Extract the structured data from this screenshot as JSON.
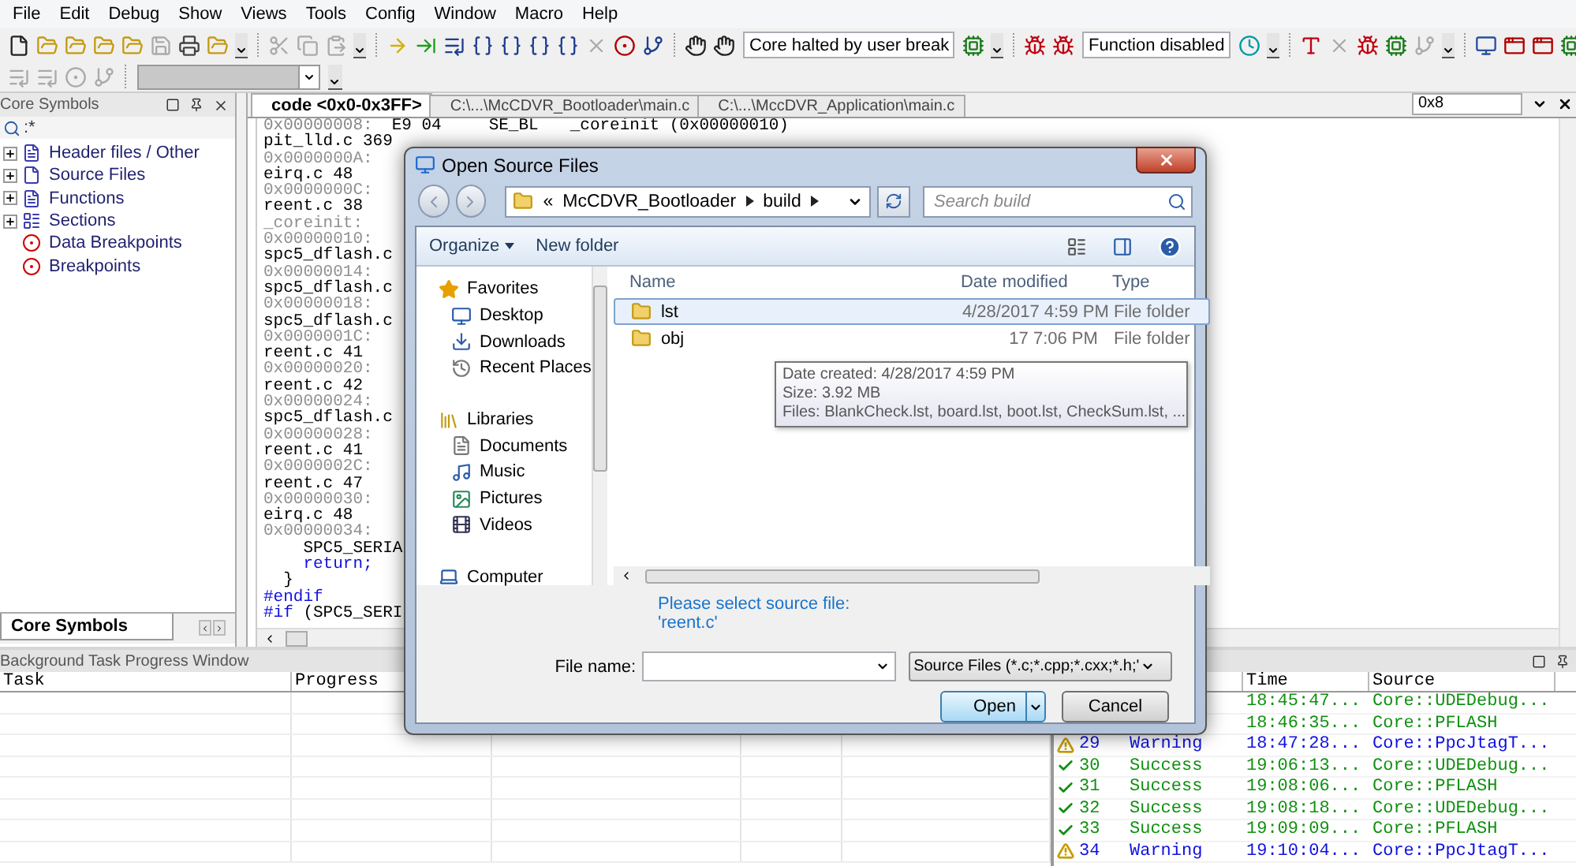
{
  "menu": [
    "File",
    "Edit",
    "Debug",
    "Show",
    "Views",
    "Tools",
    "Config",
    "Window",
    "Macro",
    "Help"
  ],
  "toolbar_row_1": [
    {
      "kind": "file",
      "disabled": false
    },
    {
      "kind": "folder",
      "disabled": false
    },
    {
      "kind": "folder",
      "disabled": false
    },
    {
      "kind": "folder",
      "disabled": false
    },
    {
      "kind": "folder",
      "disabled": false
    },
    {
      "kind": "save",
      "disabled": true
    },
    {
      "kind": "printer",
      "disabled": false
    },
    {
      "kind": "folder",
      "disabled": false
    },
    {
      "kind": "overflow"
    },
    {
      "kind": "separator"
    },
    {
      "kind": "scissors",
      "disabled": true
    },
    {
      "kind": "copy",
      "disabled": true
    },
    {
      "kind": "paste",
      "disabled": true
    },
    {
      "kind": "overflow"
    },
    {
      "kind": "separator"
    },
    {
      "kind": "arrow",
      "disabled": false
    },
    {
      "kind": "marker",
      "disabled": false
    },
    {
      "kind": "list",
      "disabled": false
    },
    {
      "kind": "braces",
      "disabled": false
    },
    {
      "kind": "braces",
      "disabled": false
    },
    {
      "kind": "braces",
      "disabled": false
    },
    {
      "kind": "braces",
      "disabled": false
    },
    {
      "kind": "cross",
      "disabled": true
    },
    {
      "kind": "record",
      "disabled": false
    },
    {
      "kind": "branch",
      "disabled": false
    },
    {
      "kind": "separator"
    },
    {
      "kind": "hand",
      "disabled": false
    },
    {
      "kind": "hand",
      "disabled": false
    },
    {
      "kind": "field",
      "value": "Core halted by user break"
    },
    {
      "kind": "chip",
      "disabled": false
    },
    {
      "kind": "overflow"
    },
    {
      "kind": "separator"
    },
    {
      "kind": "bug",
      "disabled": false
    },
    {
      "kind": "bug",
      "disabled": false
    },
    {
      "kind": "field",
      "value": "Function disabled"
    },
    {
      "kind": "clock",
      "disabled": false
    },
    {
      "kind": "overflow"
    },
    {
      "kind": "separator"
    },
    {
      "kind": "text",
      "disabled": false
    },
    {
      "kind": "cross",
      "disabled": true
    },
    {
      "kind": "bug",
      "disabled": false
    },
    {
      "kind": "chip",
      "disabled": false
    },
    {
      "kind": "branch",
      "disabled": true
    },
    {
      "kind": "overflow"
    },
    {
      "kind": "separator"
    },
    {
      "kind": "monitor",
      "disabled": false
    },
    {
      "kind": "window",
      "disabled": false
    },
    {
      "kind": "window",
      "disabled": false
    },
    {
      "kind": "chip",
      "disabled": false
    }
  ],
  "toolbar_row_2": [
    {
      "kind": "list",
      "disabled": true
    },
    {
      "kind": "list",
      "disabled": true
    },
    {
      "kind": "record",
      "disabled": true
    },
    {
      "kind": "branch",
      "disabled": true
    },
    {
      "kind": "separator"
    },
    {
      "kind": "combo",
      "disabled": true
    },
    {
      "kind": "overflow"
    }
  ],
  "symbols_panel": {
    "title": "Core Symbols",
    "filter": ":*",
    "tree": [
      {
        "label": "Header files / Other",
        "kind": "header",
        "expanded": false
      },
      {
        "label": "Source Files",
        "kind": "source",
        "expanded": false
      },
      {
        "label": "Functions",
        "kind": "functions",
        "expanded": false
      },
      {
        "label": "Sections",
        "kind": "sections",
        "expanded": false
      },
      {
        "label": "Data Breakpoints",
        "kind": "breakpoints"
      },
      {
        "label": "Breakpoints",
        "kind": "breakpoints"
      }
    ],
    "tabs": [
      {
        "label": "Core Symbols",
        "selected": true
      }
    ]
  },
  "editor": {
    "tabs": [
      {
        "label": "code <0x0-0x3FF>",
        "selected": true
      },
      {
        "label": "C:\\...\\McCDVR_Bootloader\\main.c",
        "selected": false
      },
      {
        "label": "C:\\...\\MccDVR_Application\\main.c",
        "selected": false
      }
    ],
    "address": "0x8",
    "lines": [
      {
        "kind": "disasm",
        "address": "0x00000008:",
        "bytes": "E9 04",
        "mnemonic": "SE_BL",
        "operand": "_coreinit (0x00000010)"
      },
      {
        "kind": "source",
        "text": "pit_lld.c 369"
      },
      {
        "kind": "address",
        "text": "0x0000000A:"
      },
      {
        "kind": "source",
        "text": "eirq.c 48"
      },
      {
        "kind": "address",
        "text": "0x0000000C:"
      },
      {
        "kind": "source",
        "text": "reent.c 38"
      },
      {
        "kind": "label",
        "text": "_coreinit:"
      },
      {
        "kind": "address",
        "text": "0x00000010:"
      },
      {
        "kind": "source",
        "text": "spc5_dflash.c"
      },
      {
        "kind": "address",
        "text": "0x00000014:"
      },
      {
        "kind": "source",
        "text": "spc5_dflash.c"
      },
      {
        "kind": "address",
        "text": "0x00000018:"
      },
      {
        "kind": "source",
        "text": "spc5_dflash.c"
      },
      {
        "kind": "address",
        "text": "0x0000001C:"
      },
      {
        "kind": "source",
        "text": "reent.c 41"
      },
      {
        "kind": "address",
        "text": "0x00000020:"
      },
      {
        "kind": "source",
        "text": "reent.c 42"
      },
      {
        "kind": "address",
        "text": "0x00000024:"
      },
      {
        "kind": "source",
        "text": "spc5_dflash.c"
      },
      {
        "kind": "address",
        "text": "0x00000028:"
      },
      {
        "kind": "source",
        "text": "reent.c 41"
      },
      {
        "kind": "address",
        "text": "0x0000002C:"
      },
      {
        "kind": "source",
        "text": "reent.c 47"
      },
      {
        "kind": "address",
        "text": "0x00000030:"
      },
      {
        "kind": "source",
        "text": "eirq.c 48"
      },
      {
        "kind": "address",
        "text": "0x00000034:"
      },
      {
        "kind": "code",
        "text": "    SPC5_SERIA"
      },
      {
        "kind": "keyword",
        "text": "    return;"
      },
      {
        "kind": "code",
        "text": "  }"
      },
      {
        "kind": "keyword",
        "text": "#endif"
      },
      {
        "kind": "directive",
        "keyword": "#if",
        "text": " (SPC5_SERI"
      }
    ]
  },
  "background_tasks": {
    "title": "Background Task Progress Window",
    "columns": [
      "Task",
      "Progress"
    ]
  },
  "messages": {
    "columns": [
      "Time",
      "Source"
    ],
    "rows": [
      {
        "kind": "success",
        "time": "18:45:47...",
        "source": "Core::UDEDebug..."
      },
      {
        "kind": "success",
        "time": "18:46:35...",
        "source": "Core::PFLASH"
      },
      {
        "kind": "warning",
        "number": "29",
        "status": "Warning",
        "time": "18:47:28...",
        "source": "Core::PpcJtagT..."
      },
      {
        "kind": "success",
        "number": "30",
        "status": "Success",
        "time": "19:06:13...",
        "source": "Core::UDEDebug..."
      },
      {
        "kind": "success",
        "number": "31",
        "status": "Success",
        "time": "19:08:06...",
        "source": "Core::PFLASH"
      },
      {
        "kind": "success",
        "number": "32",
        "status": "Success",
        "time": "19:08:18...",
        "source": "Core::UDEDebug..."
      },
      {
        "kind": "success",
        "number": "33",
        "status": "Success",
        "time": "19:09:09...",
        "source": "Core::PFLASH"
      },
      {
        "kind": "warning",
        "number": "34",
        "status": "Warning",
        "time": "19:10:04...",
        "source": "Core::PpcJtagT..."
      }
    ]
  },
  "dialog": {
    "title": "Open Source Files",
    "path": {
      "overflow_mark": "«",
      "segments": [
        "McCDVR_Bootloader",
        "build"
      ]
    },
    "search": {
      "placeholder": "Search build"
    },
    "commands": [
      "Organize",
      "New folder"
    ],
    "navigation": [
      {
        "label": "Favorites",
        "kind": "favorites",
        "children": [
          {
            "label": "Desktop",
            "kind": "desktop"
          },
          {
            "label": "Downloads",
            "kind": "downloads"
          },
          {
            "label": "Recent Places",
            "kind": "recent"
          }
        ]
      },
      {
        "label": "Libraries",
        "kind": "libraries",
        "children": [
          {
            "label": "Documents",
            "kind": "documents"
          },
          {
            "label": "Music",
            "kind": "music"
          },
          {
            "label": "Pictures",
            "kind": "pictures"
          },
          {
            "label": "Videos",
            "kind": "videos"
          }
        ]
      },
      {
        "label": "Computer",
        "kind": "computer"
      }
    ],
    "columns": [
      "Name",
      "Date modified",
      "Type"
    ],
    "files": [
      {
        "name": "lst",
        "date": "4/28/2017 4:59 PM",
        "type": "File folder",
        "selected": true
      },
      {
        "name": "obj",
        "date": "17 7:06 PM",
        "type": "File folder",
        "selected": false
      }
    ],
    "tooltip": [
      "Date created: 4/28/2017 4:59 PM",
      "Size: 3.92 MB",
      "Files: BlankCheck.lst, board.lst, boot.lst, CheckSum.lst, ..."
    ],
    "message": [
      "Please select source file:",
      "'reent.c'"
    ],
    "file_name_label": "File name:",
    "file_type": "Source Files (*.c;*.cpp;*.cxx;*.h;'",
    "buttons": [
      {
        "label": "Open",
        "kind": "default"
      },
      {
        "label": "Cancel",
        "kind": "normal"
      }
    ]
  }
}
